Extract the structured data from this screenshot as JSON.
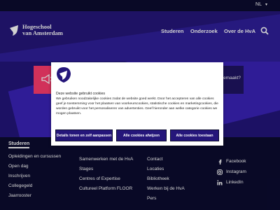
{
  "topbar": {
    "language": "NL",
    "chevron": "▾"
  },
  "header": {
    "logo_line1": "Hogeschool",
    "logo_line2": "van Amsterdam",
    "nav": [
      "Studeren",
      "Onderzoek",
      "Over de HvA"
    ],
    "search_icon": "search-icon"
  },
  "hero": {
    "text": "emaakt?",
    "icon": "megaphone-icon"
  },
  "footer": {
    "col1": {
      "title": "Studeren",
      "items": [
        "Opleidingen en cursussen",
        "Open dag",
        "Inschrijven",
        "Collegegeld",
        "Jaarrooster"
      ]
    },
    "col2": {
      "items": [
        "Samenwerken met de HvA",
        "Stages",
        "Centres of Expertise",
        "Cultureel Platform FLOOR"
      ]
    },
    "col3": {
      "items": [
        "Contact",
        "Locaties",
        "Bibliotheek",
        "Werken bij de HvA",
        "Pers"
      ]
    },
    "social": [
      {
        "label": "Facebook",
        "icon": "facebook-icon"
      },
      {
        "label": "Instagram",
        "icon": "instagram-icon"
      },
      {
        "label": "LinkedIn",
        "icon": "linkedin-icon"
      }
    ]
  },
  "cookie": {
    "title": "Deze website gebruikt cookies",
    "body": "We gebruiken noodzakelijke cookies zodat de website goed werkt. Door het accepteren van alle cookies geef je toestemming voor het plaatsen van voorkeurscookies, statistische cookies en marketingcookies, die worden gebruikt voor het personaliseren van advertenties. Geef hieronder aan welke categorie cookies we mogen plaatsen.",
    "btn_details": "Details tonen en zelf aanpassen",
    "btn_reject": "Alle cookies afwijzen",
    "btn_accept": "Alle cookies toestaan"
  },
  "colors": {
    "brand_dark": "#25167a",
    "accent_pink": "#ff3c6e",
    "footer_bg": "#0b0b2f"
  }
}
